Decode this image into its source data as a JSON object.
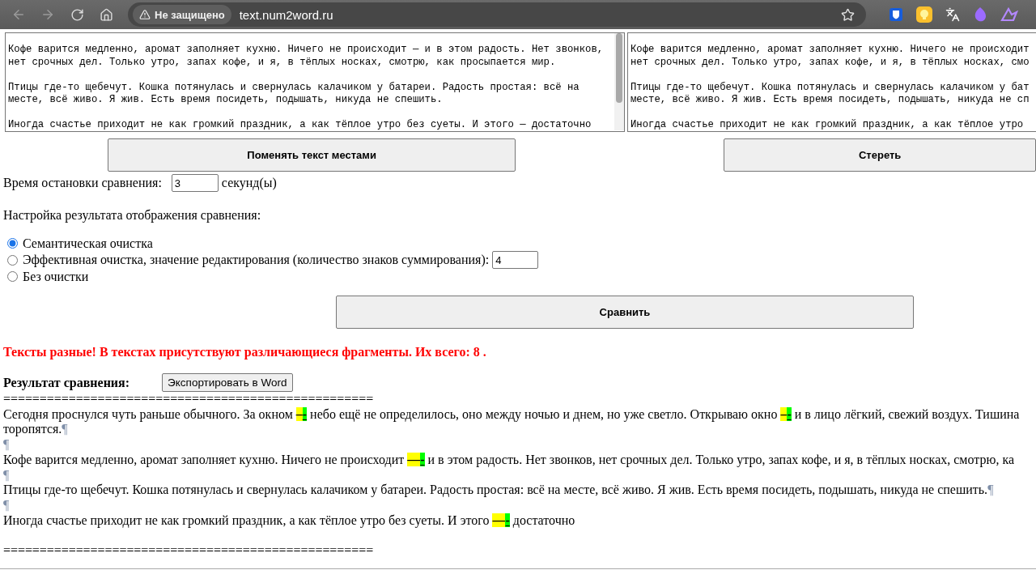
{
  "browser": {
    "security_label": "Не защищено",
    "url": "text.num2word.ru"
  },
  "texts": {
    "left": {
      "paragraphs": [
        [
          "Кофе варится медленно, аромат заполняет кухню. Ничего не происходит — и в этом радость. Нет звонков,",
          "нет срочных дел. Только утро, запах кофе, и я, в тёплых носках, смотрю, как просыпается мир."
        ],
        [
          "Птицы где-то щебечут. Кошка потянулась и свернулась калачиком у батареи. Радость простая: всё на",
          "месте, всё живо. Я жив. Есть время посидеть, подышать, никуда не спешить."
        ],
        [
          "Иногда счастье приходит не как громкий праздник, а как тёплое утро без суеты. И этого — достаточно"
        ]
      ]
    },
    "right": {
      "paragraphs": [
        [
          "Кофе варится медленно, аромат заполняет кухню. Ничего не происходит",
          "нет срочных дел. Только утро, запах кофе, и я, в тёплых носках, смо"
        ],
        [
          "Птицы где-то щебечут. Кошка потянулась и свернулась калачиком у бат",
          "месте, всё живо. Я жив. Есть время посидеть, подышать, никуда не сп"
        ],
        [
          "Иногда счастье приходит не как громкий праздник, а как тёплое утро"
        ]
      ]
    }
  },
  "swap_button": "Поменять текст местами",
  "clear_button": "Стереть",
  "timeout": {
    "label": "Время остановки сравнения:",
    "value": "3",
    "unit": "секунд(ы)"
  },
  "settings": {
    "title": "Настройка результата отображения сравнения:",
    "options": [
      {
        "label": "Семантическая очистка",
        "selected": true
      },
      {
        "label": "Эффективная очистка, значение редактирования (количество знаков суммирования):",
        "selected": false,
        "value": "4"
      },
      {
        "label": "Без очистки",
        "selected": false
      }
    ]
  },
  "compare_button": "Сравнить",
  "message": "Тексты разные! В текстах присутствуют различающиеся фрагменты. Их всего: 8 .",
  "result": {
    "label": "Результат сравнения:",
    "export_button": "Экспортировать в Word",
    "separator": "===================================================",
    "lines": [
      {
        "segments": [
          {
            "kind": "text",
            "text": "Сегодня проснулся чуть раньше обычного. За окном "
          },
          {
            "kind": "del",
            "text": "–"
          },
          {
            "kind": "ins",
            "text": "-"
          },
          {
            "kind": "text",
            "text": " небо ещё не определилось, оно между ночью и днем, но уже светло. Открываю окно "
          },
          {
            "kind": "del",
            "text": "–"
          },
          {
            "kind": "ins",
            "text": "-"
          },
          {
            "kind": "text",
            "text": " и в лицо лёгкий, свежий воздух. Тишина"
          }
        ]
      },
      {
        "segments": [
          {
            "kind": "text",
            "text": "торопятся."
          },
          {
            "kind": "pilcrow",
            "text": "¶"
          }
        ]
      },
      {
        "segments": [
          {
            "kind": "pilcrow",
            "text": "¶"
          }
        ]
      },
      {
        "segments": [
          {
            "kind": "text",
            "text": "Кофе варится медленно, аромат заполняет кухню. Ничего не происходит "
          },
          {
            "kind": "del",
            "text": "—"
          },
          {
            "kind": "ins",
            "text": "-"
          },
          {
            "kind": "text",
            "text": " и в этом радость. Нет звонков, нет срочных дел. Только утро, запах кофе, и я, в тёплых носках, смотрю, ка"
          }
        ]
      },
      {
        "segments": [
          {
            "kind": "pilcrow",
            "text": "¶"
          }
        ]
      },
      {
        "segments": [
          {
            "kind": "text",
            "text": "Птицы где-то щебечут. Кошка потянулась и свернулась калачиком у батареи. Радость простая: всё на месте, всё живо. Я жив. Есть время посидеть, подышать, никуда не спешить."
          },
          {
            "kind": "pilcrow",
            "text": "¶"
          }
        ]
      },
      {
        "segments": [
          {
            "kind": "pilcrow",
            "text": "¶"
          }
        ]
      },
      {
        "segments": [
          {
            "kind": "text",
            "text": "Иногда счастье приходит не как громкий праздник, а как тёплое утро без суеты. И этого "
          },
          {
            "kind": "del",
            "text": "—"
          },
          {
            "kind": "ins",
            "text": "-"
          },
          {
            "kind": "text",
            "text": " достаточно"
          }
        ]
      }
    ],
    "closing_separator": "==================================================="
  }
}
